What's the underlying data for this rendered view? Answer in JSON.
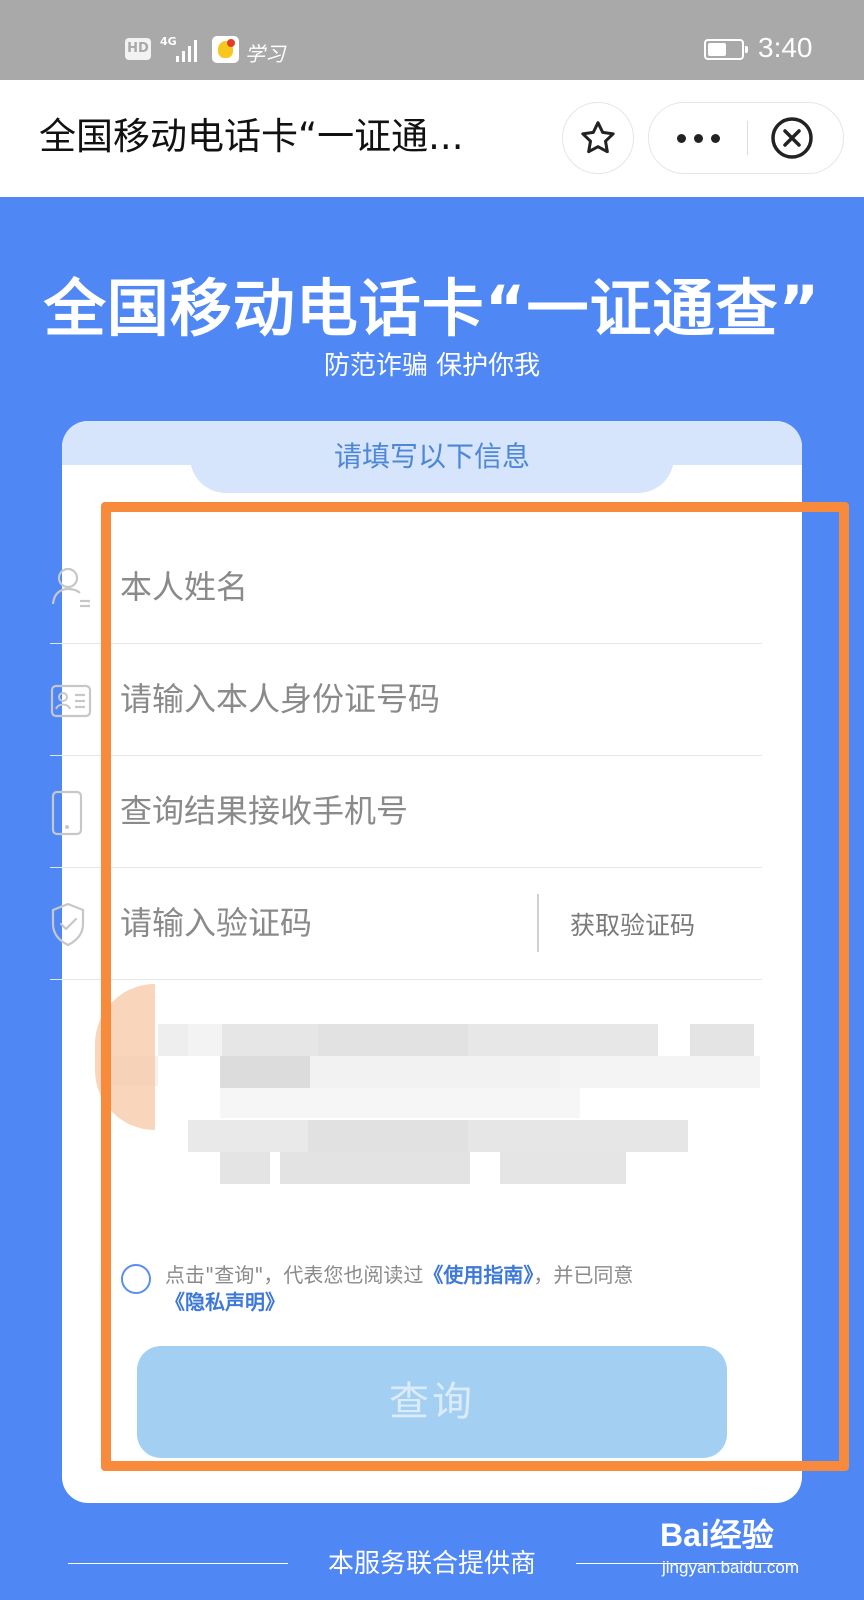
{
  "status_bar": {
    "hd": "HD",
    "network": "4G",
    "app_text": "学习",
    "time": "3:40"
  },
  "title_bar": {
    "title": "全国移动电话卡“一证通...",
    "icons": [
      "star-icon",
      "more-icon",
      "close-circle-icon"
    ]
  },
  "hero": {
    "title": "全国移动电话卡“一证通查”",
    "subtitle": "防范诈骗 保护你我"
  },
  "form": {
    "header": "请填写以下信息",
    "name_placeholder": "本人姓名",
    "id_placeholder": "请输入本人身份证号码",
    "phone_placeholder": "查询结果接收手机号",
    "code_placeholder": "请输入验证码",
    "get_code": "获取验证码",
    "agree_prefix": "点击\"查询\"，代表您也阅读过",
    "guide_link": "《使用指南》",
    "agree_mid": "，并已同意",
    "privacy_link": "《隐私声明》",
    "query_button": "查询"
  },
  "footer": {
    "text": "本服务联合提供商"
  },
  "watermark": {
    "logo": "Bai经验",
    "url": "jingyan.baidu.com"
  },
  "colors": {
    "background": "#4f87f5",
    "highlight": "#f78a3b",
    "button": "#a3cff2",
    "link": "#3e78d8"
  }
}
